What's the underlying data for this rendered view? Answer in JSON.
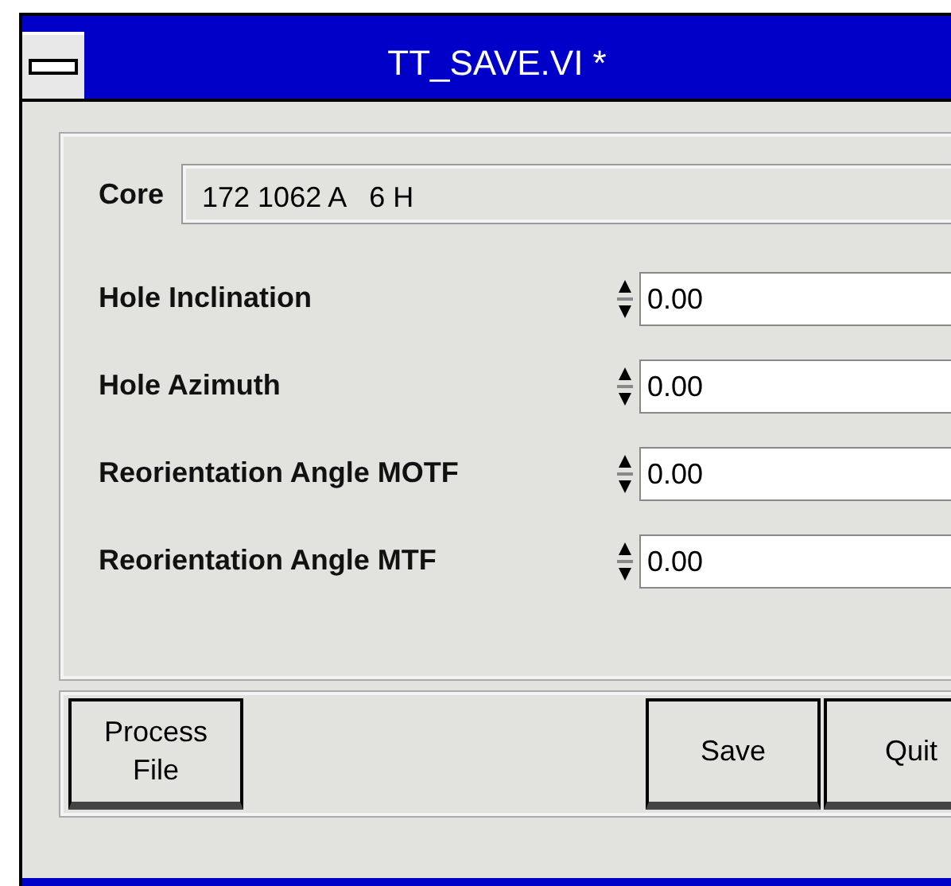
{
  "window": {
    "title": "TT_SAVE.VI *"
  },
  "core": {
    "label": "Core",
    "value": "172 1062 A   6 H"
  },
  "fields": [
    {
      "label": "Hole Inclination",
      "value": "0.00"
    },
    {
      "label": "Hole Azimuth",
      "value": "0.00"
    },
    {
      "label": "Reorientation Angle MOTF",
      "value": "0.00"
    },
    {
      "label": "Reorientation Angle MTF",
      "value": "0.00"
    }
  ],
  "buttons": [
    {
      "label": "Process\nFile",
      "kind": "left"
    },
    {
      "label": "Save",
      "kind": "right"
    },
    {
      "label": "Quit",
      "kind": "right"
    }
  ]
}
